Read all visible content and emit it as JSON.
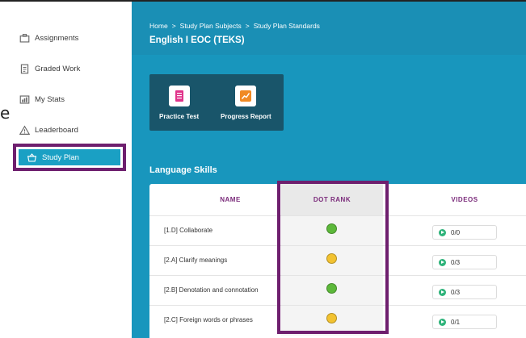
{
  "sidebar": {
    "items": [
      {
        "label": "Assignments",
        "icon": "briefcase-icon"
      },
      {
        "label": "Graded Work",
        "icon": "document-icon"
      },
      {
        "label": "My Stats",
        "icon": "stats-icon"
      },
      {
        "label": "Leaderboard",
        "icon": "warning-triangle-icon"
      },
      {
        "label": "Study Plan",
        "icon": "basket-icon",
        "active": true
      }
    ],
    "stray_glyph": "e"
  },
  "header": {
    "breadcrumb": [
      "Home",
      "Study Plan Subjects",
      "Study Plan Standards"
    ],
    "breadcrumb_separator": ">",
    "title": "English I EOC (TEKS)"
  },
  "tools": [
    {
      "label": "Practice Test",
      "icon": "clipboard-icon",
      "color": "#e0338a"
    },
    {
      "label": "Progress Report",
      "icon": "chart-line-icon",
      "color": "#f08a24"
    }
  ],
  "section": {
    "title": "Language Skills"
  },
  "table": {
    "columns": [
      "NAME",
      "DOT RANK",
      "VIDEOS"
    ],
    "rows": [
      {
        "name": "[1.D] Collaborate",
        "dot": "green",
        "videos": "0/0"
      },
      {
        "name": "[2.A] Clarify meanings",
        "dot": "yellow",
        "videos": "0/3"
      },
      {
        "name": "[2.B] Denotation and connotation",
        "dot": "green",
        "videos": "0/3"
      },
      {
        "name": "[2.C] Foreign words or phrases",
        "dot": "yellow",
        "videos": "0/1"
      }
    ]
  },
  "colors": {
    "accent_teal": "#1896bd",
    "highlight_frame": "#6e1f6e",
    "dot_green": "#5cb83a",
    "dot_yellow": "#f2c230",
    "play_green": "#2eb37a"
  }
}
